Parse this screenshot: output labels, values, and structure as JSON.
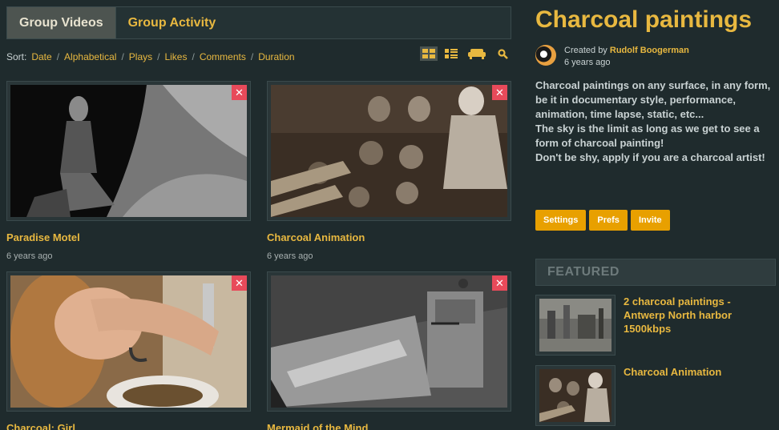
{
  "tabs": [
    {
      "label": "Group Videos",
      "active": true
    },
    {
      "label": "Group Activity",
      "active": false
    }
  ],
  "sort": {
    "label": "Sort:",
    "options": [
      "Date",
      "Alphabetical",
      "Plays",
      "Likes",
      "Comments",
      "Duration"
    ],
    "separator": "/"
  },
  "view_tools": [
    "grid-view-icon",
    "list-view-icon",
    "couch-icon",
    "search-icon"
  ],
  "videos": [
    {
      "title": "Paradise Motel",
      "age": "6 years ago",
      "remove": "✕"
    },
    {
      "title": "Charcoal Animation",
      "age": "6 years ago",
      "remove": "✕"
    },
    {
      "title": "Charcoal: Girl",
      "age": "",
      "remove": "✕"
    },
    {
      "title": "Mermaid of the Mind",
      "age": "",
      "remove": "✕"
    }
  ],
  "group": {
    "title": "Charcoal paintings",
    "created_by_label": "Created by",
    "creator": "Rudolf Boogerman",
    "age": "6 years ago",
    "description": [
      "Charcoal paintings on any surface, in any form, be it in documentary style, performance, animation, time lapse, static, etc...",
      "The sky is the limit as long as we get to see a form of charcoal painting!",
      "Don't be shy, apply if you are a charcoal artist!"
    ],
    "buttons": [
      "Settings",
      "Prefs",
      "Invite"
    ]
  },
  "featured": {
    "heading": "FEATURED",
    "items": [
      {
        "title": "2 charcoal paintings - Antwerp North harbor 1500kbps"
      },
      {
        "title": "Charcoal Animation"
      }
    ]
  },
  "colors": {
    "accent": "#e8b840",
    "button": "#e8a000",
    "remove": "#e84a5a",
    "background": "#1f2b2d"
  }
}
